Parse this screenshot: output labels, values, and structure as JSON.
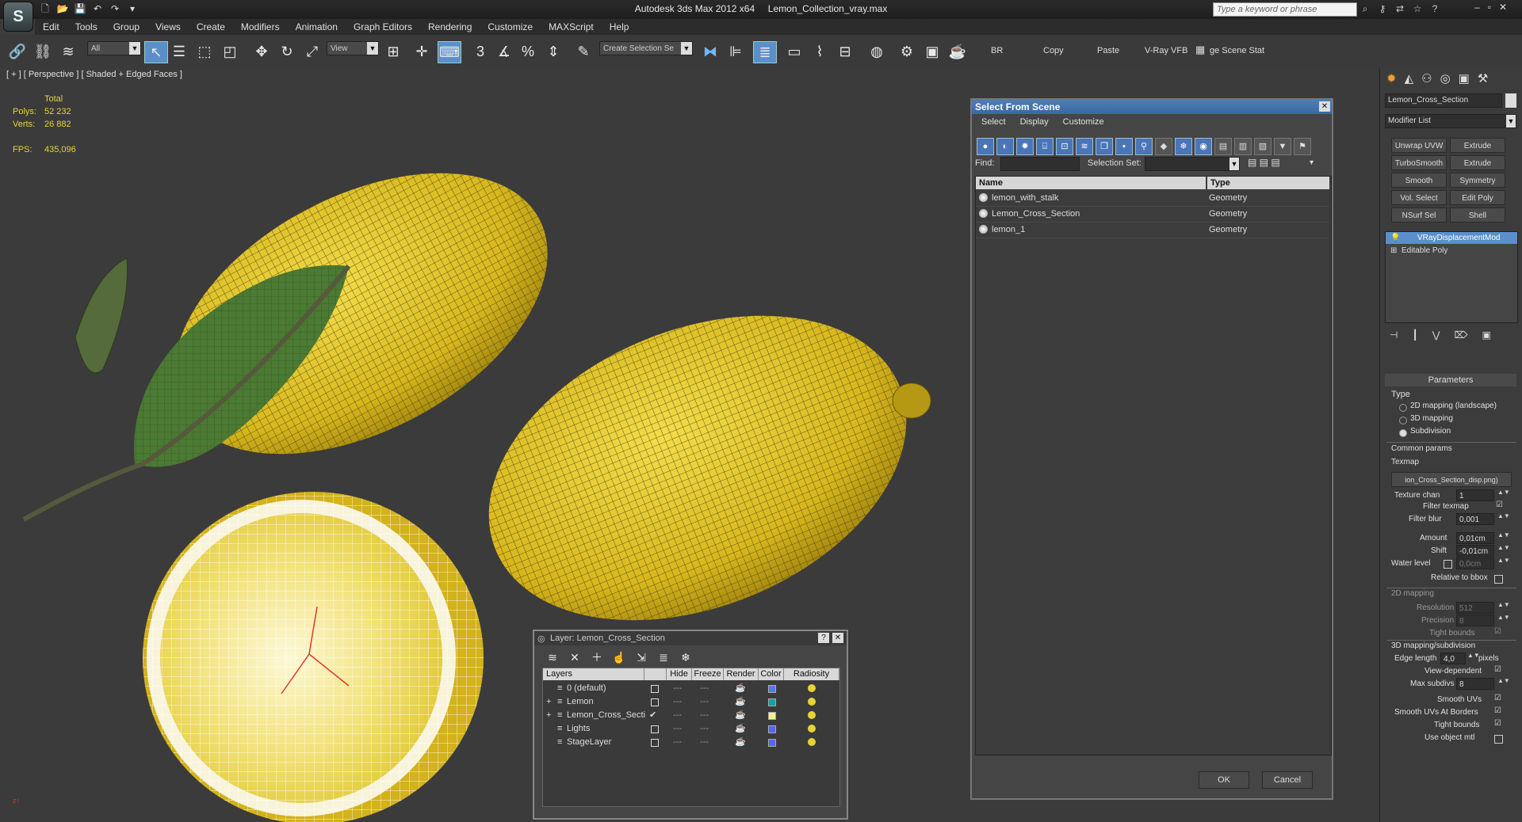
{
  "window": {
    "app_title": "Autodesk 3ds Max  2012 x64",
    "file_title": "Lemon_Collection_vray.max",
    "logo_glyph": "S",
    "search_placeholder": "Type a keyword or phrase",
    "controls": {
      "minimize": "–",
      "restore": "▫",
      "close": "✕"
    },
    "top_icons": [
      "binoculars-icon",
      "key-icon",
      "exchange-icon",
      "star-icon",
      "help-icon"
    ]
  },
  "menu": [
    "Edit",
    "Tools",
    "Group",
    "Views",
    "Create",
    "Modifiers",
    "Animation",
    "Graph Editors",
    "Rendering",
    "Customize",
    "MAXScript",
    "Help"
  ],
  "toolbar": {
    "filter": "All",
    "ref_coord": "View",
    "selection_set": "Create Selection Se",
    "labels": {
      "br": "BR",
      "copy": "Copy",
      "paste": "Paste",
      "vfb": "V-Ray VFB",
      "scene_stat": "ge Scene Stat"
    }
  },
  "viewport": {
    "label": "[ + ] [ Perspective ] [ Shaded + Edged Faces ]",
    "stats": {
      "total_label": "Total",
      "polys_label": "Polys:",
      "polys": "52 232",
      "verts_label": "Verts:",
      "verts": "26 882",
      "fps_label": "FPS:",
      "fps": "435,096"
    },
    "colors": {
      "lemon": "#e6c624",
      "wire": "#3d3a16",
      "leaf": "#4a7a33",
      "pulp": "#f2e27a"
    }
  },
  "select_from_scene": {
    "title": "Select From Scene",
    "menu": [
      "Select",
      "Display",
      "Customize"
    ],
    "find_label": "Find:",
    "selection_set_label": "Selection Set:",
    "columns": {
      "name": "Name",
      "type": "Type"
    },
    "rows": [
      {
        "name": "lemon_with_stalk",
        "type": "Geometry"
      },
      {
        "name": "Lemon_Cross_Section",
        "type": "Geometry"
      },
      {
        "name": "lemon_1",
        "type": "Geometry"
      }
    ],
    "ok": "OK",
    "cancel": "Cancel"
  },
  "layer_dialog": {
    "title": "Layer: Lemon_Cross_Section",
    "help": "?",
    "close": "✕",
    "columns": [
      "Layers",
      "Hide",
      "Freeze",
      "Render",
      "Color",
      "Radiosity"
    ],
    "rows": [
      {
        "name": "0 (default)",
        "color": "#5577ee",
        "expand": ""
      },
      {
        "name": "Lemon",
        "color": "#1aa0a0",
        "expand": "+"
      },
      {
        "name": "Lemon_Cross_Secti",
        "color": "#f2f08a",
        "expand": "+"
      },
      {
        "name": "Lights",
        "color": "#5566ee",
        "expand": ""
      },
      {
        "name": "StageLayer",
        "color": "#5566ee",
        "expand": ""
      }
    ]
  },
  "command_panel": {
    "object_name": "Lemon_Cross_Section",
    "modifier_list": "Modifier List",
    "buttons": [
      [
        "Unwrap UVW",
        "Extrude"
      ],
      [
        "TurboSmooth",
        "Extrude"
      ],
      [
        "Smooth",
        "Symmetry"
      ],
      [
        "Vol. Select",
        "Edit Poly"
      ],
      [
        "NSurf Sel",
        "Shell"
      ]
    ],
    "stack": [
      "VRayDisplacementMod",
      "Editable Poly"
    ],
    "rollout": "Parameters",
    "type_label": "Type",
    "type_options": [
      "2D mapping (landscape)",
      "3D mapping",
      "Subdivision"
    ],
    "common_params": "Common params",
    "texmap_label": "Texmap",
    "texmap_value": "ion_Cross_Section_disp.png)",
    "texture_chan_label": "Texture chan",
    "texture_chan": "1",
    "filter_texmap": "Filter texmap",
    "filter_blur_label": "Filter blur",
    "filter_blur": "0,001",
    "amount_label": "Amount",
    "amount": "0,01cm",
    "shift_label": "Shift",
    "shift": "-0,01cm",
    "water_level_label": "Water level",
    "water_level": "0,0cm",
    "relative_bbox": "Relative to bbox",
    "mapping_2d": "2D mapping",
    "resolution_label": "Resolution",
    "resolution": "512",
    "precision_label": "Precision",
    "precision": "8",
    "tight_bounds": "Tight bounds",
    "mapping_3d": "3D mapping/subdivision",
    "edge_length_label": "Edge length",
    "edge_length": "4,0",
    "pixels": "pixels",
    "view_dependent": "View-dependent",
    "max_subdivs_label": "Max subdivs",
    "max_subdivs": "8",
    "smooth_uvs": "Smooth UVs",
    "smooth_uvs_borders": "Smooth UVs At Borders",
    "tight_bounds2": "Tight bounds",
    "use_object_mtl": "Use object mtl"
  }
}
